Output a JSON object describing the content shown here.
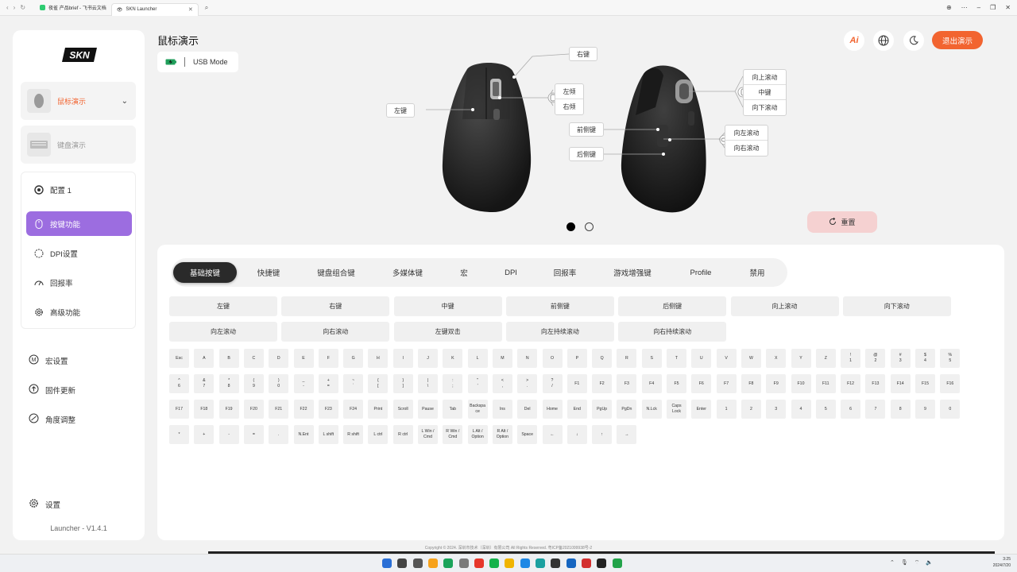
{
  "browser": {
    "tabs": [
      {
        "label": "夜雀 产品brief - 飞书云文档"
      },
      {
        "label": "SKN Launcher"
      }
    ]
  },
  "app": {
    "logo": "SKN",
    "title": "鼠标演示",
    "connection_mode": "USB Mode",
    "exit_label": "退出演示",
    "ai_label": "Ai",
    "accent": "#9c6de0",
    "exit_color": "#f26430"
  },
  "sidebar": {
    "devices": [
      {
        "label": "鼠标演示",
        "active": true
      },
      {
        "label": "键盘演示",
        "active": false
      }
    ],
    "config_label": "配置 1",
    "config_menu": [
      {
        "label": "按键功能",
        "icon": "mouse-icon",
        "active": true
      },
      {
        "label": "DPI设置",
        "icon": "dpi-icon",
        "active": false
      },
      {
        "label": "回报率",
        "icon": "rate-icon",
        "active": false
      },
      {
        "label": "高级功能",
        "icon": "gear-icon",
        "active": false
      }
    ],
    "extra_menu": [
      {
        "label": "宏设置",
        "icon": "macro-icon"
      },
      {
        "label": "固件更新",
        "icon": "upload-icon"
      },
      {
        "label": "角度调整",
        "icon": "angle-icon"
      }
    ],
    "settings_label": "设置",
    "version": "Launcher - V1.4.1"
  },
  "diagram": {
    "left_key": "左键",
    "right_key": "右键",
    "tilt_left": "左倾",
    "tilt_right": "右倾",
    "scroll_up": "向上滚动",
    "middle_key": "中键",
    "scroll_down": "向下滚动",
    "front_side": "前侧键",
    "back_side": "后侧键",
    "scroll_left": "向左滚动",
    "scroll_right": "向右滚动",
    "reset_label": "重置",
    "pager": {
      "current": 1,
      "total": 2
    }
  },
  "panel": {
    "tabs": [
      "基础按键",
      "快捷键",
      "键盘组合键",
      "多媒体键",
      "宏",
      "DPI",
      "回报率",
      "游戏增强键",
      "Profile",
      "禁用"
    ],
    "active_tab": 0,
    "function_buttons": [
      [
        "左键",
        "右键",
        "中键",
        "前侧键",
        "后侧键",
        "向上滚动",
        "向下滚动"
      ],
      [
        "向左滚动",
        "向右滚动",
        "左键双击",
        "向左持续滚动",
        "向右持续滚动"
      ]
    ],
    "keys": [
      [
        "Esc",
        "A",
        "B",
        "C",
        "D",
        "E",
        "F",
        "G",
        "H",
        "I",
        "J",
        "K",
        "L",
        "M",
        "N",
        "O",
        "P",
        "Q",
        "R",
        "S",
        "T",
        "U",
        "V",
        "W",
        "X",
        "Y",
        "Z",
        "!\n1",
        "@\n2",
        "#\n3",
        "$\n4",
        "%\n5"
      ],
      [
        "^\n6",
        "&\n7",
        "*\n8",
        "(\n9",
        ")\n0",
        "_\n-",
        "+\n=",
        "~\n`",
        "{\n[",
        "}\n]",
        "|\n\\",
        ":\n;",
        "\"\n'",
        "<\n,",
        ">\n.",
        "?\n/",
        "F1",
        "F2",
        "F3",
        "F4",
        "F5",
        "F6",
        "F7",
        "F8",
        "F9",
        "F10",
        "F11",
        "F12",
        "F13",
        "F14",
        "F15",
        "F16"
      ],
      [
        "F17",
        "F18",
        "F19",
        "F20",
        "F21",
        "F22",
        "F23",
        "F24",
        "Print",
        "Scroll",
        "Pause",
        "Tab",
        "Backspa\nce",
        "Ins",
        "Del",
        "Home",
        "End",
        "PgUp",
        "PgDn",
        "N.Lck",
        "Caps\nLock",
        "Enter",
        "1",
        "2",
        "3",
        "4",
        "5",
        "6",
        "7",
        "8",
        "9",
        "0"
      ],
      [
        "*",
        "+",
        "-",
        "=",
        ".",
        "N.Ent",
        "L shift",
        "R shift",
        "L ctrl",
        "R ctrl",
        "L Win /\nCmd",
        "R Win /\nCmd",
        "L Alt /\nOption",
        "R Alt /\nOption",
        "Space",
        "←",
        "↓",
        "↑",
        "→"
      ]
    ]
  },
  "footer": "Copyright © 2024. 深圳市技术（深圳）有限公司 All Rights Reserved. 粤ICP备2021099938号-2",
  "taskbar": {
    "time": "3:25",
    "date": "2024/7/20"
  }
}
